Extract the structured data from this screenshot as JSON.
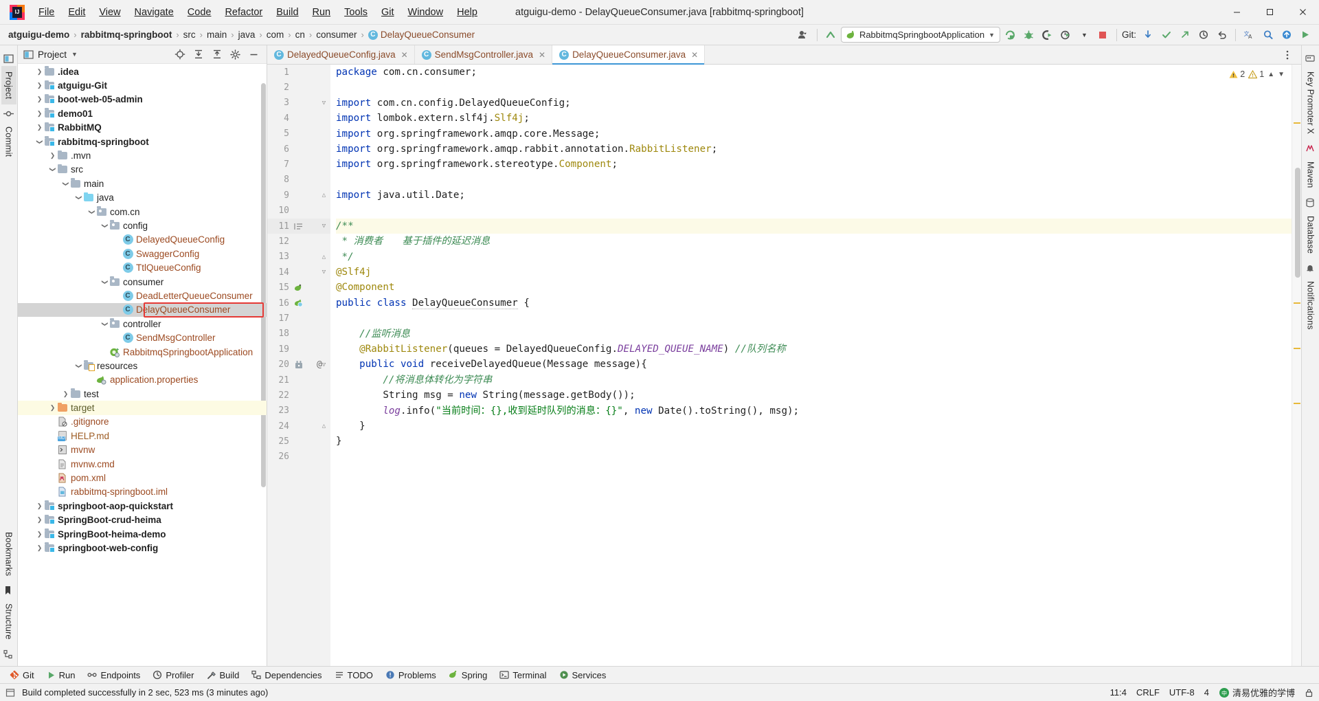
{
  "window": {
    "title": "atguigu-demo - DelayQueueConsumer.java [rabbitmq-springboot]",
    "minimize": "–",
    "maximize": "☐",
    "close": "✕"
  },
  "menubar": {
    "items": [
      {
        "label": "File",
        "mnemonic": "F"
      },
      {
        "label": "Edit",
        "mnemonic": "E"
      },
      {
        "label": "View",
        "mnemonic": "V"
      },
      {
        "label": "Navigate",
        "mnemonic": "N"
      },
      {
        "label": "Code",
        "mnemonic": "C"
      },
      {
        "label": "Refactor",
        "mnemonic": "R"
      },
      {
        "label": "Build",
        "mnemonic": "B"
      },
      {
        "label": "Run",
        "mnemonic": "u"
      },
      {
        "label": "Tools",
        "mnemonic": "T"
      },
      {
        "label": "Git",
        "mnemonic": "G"
      },
      {
        "label": "Window",
        "mnemonic": "W"
      },
      {
        "label": "Help",
        "mnemonic": "H"
      }
    ]
  },
  "navbar": {
    "breadcrumbs": [
      {
        "label": "atguigu-demo",
        "bold": true,
        "kind": "project"
      },
      {
        "label": "rabbitmq-springboot",
        "bold": true,
        "kind": "module"
      },
      {
        "label": "src",
        "bold": false,
        "kind": "folder"
      },
      {
        "label": "main",
        "bold": false,
        "kind": "folder"
      },
      {
        "label": "java",
        "bold": false,
        "kind": "folder"
      },
      {
        "label": "com",
        "bold": false,
        "kind": "package"
      },
      {
        "label": "cn",
        "bold": false,
        "kind": "package"
      },
      {
        "label": "consumer",
        "bold": false,
        "kind": "package"
      },
      {
        "label": "DelayQueueConsumer",
        "bold": false,
        "kind": "class"
      }
    ],
    "separator": "›",
    "run_configuration": "RabbitmqSpringbootApplication",
    "git_label": "Git:",
    "icons": [
      "user-avatar-icon",
      "updates-arrow-icon",
      "run-icon",
      "debug-icon",
      "run-with-coverage-icon",
      "profiler-icon",
      "stop-icon",
      "git-pull-icon",
      "git-commit-icon",
      "git-push-icon",
      "git-history-icon",
      "undo-icon",
      "translate-icon",
      "search-everywhere-icon",
      "plugin-update-icon",
      "run-big-icon"
    ]
  },
  "left_rail": {
    "items": [
      {
        "label": "Project",
        "selected": true
      },
      {
        "label": "Commit",
        "selected": false
      }
    ],
    "bottom_items": [
      {
        "label": "Bookmarks"
      },
      {
        "label": "Structure"
      }
    ]
  },
  "right_rail": {
    "items": [
      {
        "label": "Key Promoter X"
      },
      {
        "label": "Maven"
      },
      {
        "label": "Database"
      },
      {
        "label": "Notifications"
      }
    ]
  },
  "project_panel": {
    "title": "Project",
    "actions": [
      "locate-icon",
      "expand-all-icon",
      "collapse-all-icon",
      "settings-gear-icon",
      "hide-icon"
    ],
    "tree": [
      {
        "label": ".idea",
        "indent": 1,
        "arrow": "collapsed",
        "icon": "folder",
        "style": "bold",
        "clipped": true
      },
      {
        "label": "atguigu-Git",
        "indent": 1,
        "arrow": "collapsed",
        "icon": "module",
        "style": "bold"
      },
      {
        "label": "boot-web-05-admin",
        "indent": 1,
        "arrow": "collapsed",
        "icon": "module",
        "style": "bold"
      },
      {
        "label": "demo01",
        "indent": 1,
        "arrow": "collapsed",
        "icon": "module",
        "style": "bold"
      },
      {
        "label": "RabbitMQ",
        "indent": 1,
        "arrow": "collapsed",
        "icon": "module",
        "style": "bold"
      },
      {
        "label": "rabbitmq-springboot",
        "indent": 1,
        "arrow": "expanded",
        "icon": "module",
        "style": "bold"
      },
      {
        "label": ".mvn",
        "indent": 2,
        "arrow": "collapsed",
        "icon": "folder",
        "style": "plain"
      },
      {
        "label": "src",
        "indent": 2,
        "arrow": "expanded",
        "icon": "folder",
        "style": "plain"
      },
      {
        "label": "main",
        "indent": 3,
        "arrow": "expanded",
        "icon": "folder",
        "style": "plain"
      },
      {
        "label": "java",
        "indent": 4,
        "arrow": "expanded",
        "icon": "source-folder",
        "style": "plain"
      },
      {
        "label": "com.cn",
        "indent": 5,
        "arrow": "expanded",
        "icon": "package",
        "style": "plain"
      },
      {
        "label": "config",
        "indent": 6,
        "arrow": "expanded",
        "icon": "package",
        "style": "plain"
      },
      {
        "label": "DelayedQueueConfig",
        "indent": 7,
        "arrow": "none",
        "icon": "java-class",
        "style": "class"
      },
      {
        "label": "SwaggerConfig",
        "indent": 7,
        "arrow": "none",
        "icon": "java-class",
        "style": "class"
      },
      {
        "label": "TtlQueueConfig",
        "indent": 7,
        "arrow": "none",
        "icon": "java-class",
        "style": "class"
      },
      {
        "label": "consumer",
        "indent": 6,
        "arrow": "expanded",
        "icon": "package",
        "style": "plain"
      },
      {
        "label": "DeadLetterQueueConsumer",
        "indent": 7,
        "arrow": "none",
        "icon": "java-class",
        "style": "class"
      },
      {
        "label": "DelayQueueConsumer",
        "indent": 7,
        "arrow": "none",
        "icon": "java-class",
        "style": "class",
        "selected": true,
        "highlighted": true
      },
      {
        "label": "controller",
        "indent": 6,
        "arrow": "expanded",
        "icon": "package",
        "style": "plain"
      },
      {
        "label": "SendMsgController",
        "indent": 7,
        "arrow": "none",
        "icon": "java-class",
        "style": "class"
      },
      {
        "label": "RabbitmqSpringbootApplication",
        "indent": 6,
        "arrow": "none",
        "icon": "spring-boot-app",
        "style": "class"
      },
      {
        "label": "resources",
        "indent": 4,
        "arrow": "expanded",
        "icon": "resources-folder",
        "style": "plain"
      },
      {
        "label": "application.properties",
        "indent": 5,
        "arrow": "none",
        "icon": "spring-properties",
        "style": "class"
      },
      {
        "label": "test",
        "indent": 3,
        "arrow": "collapsed",
        "icon": "folder",
        "style": "plain"
      },
      {
        "label": "target",
        "indent": 2,
        "arrow": "collapsed",
        "icon": "excluded-folder",
        "style": "target",
        "row_highlight": true
      },
      {
        "label": ".gitignore",
        "indent": 2,
        "arrow": "none",
        "icon": "gitignore-file",
        "style": "class"
      },
      {
        "label": "HELP.md",
        "indent": 2,
        "arrow": "none",
        "icon": "markdown-file",
        "style": "markdown"
      },
      {
        "label": "mvnw",
        "indent": 2,
        "arrow": "none",
        "icon": "script-file",
        "style": "class"
      },
      {
        "label": "mvnw.cmd",
        "indent": 2,
        "arrow": "none",
        "icon": "text-file",
        "style": "class"
      },
      {
        "label": "pom.xml",
        "indent": 2,
        "arrow": "none",
        "icon": "maven-pom",
        "style": "class"
      },
      {
        "label": "rabbitmq-springboot.iml",
        "indent": 2,
        "arrow": "none",
        "icon": "module-file",
        "style": "class"
      },
      {
        "label": "springboot-aop-quickstart",
        "indent": 1,
        "arrow": "collapsed",
        "icon": "module",
        "style": "bold"
      },
      {
        "label": "SpringBoot-crud-heima",
        "indent": 1,
        "arrow": "collapsed",
        "icon": "module",
        "style": "bold"
      },
      {
        "label": "SpringBoot-heima-demo",
        "indent": 1,
        "arrow": "collapsed",
        "icon": "module",
        "style": "bold"
      },
      {
        "label": "springboot-web-config",
        "indent": 1,
        "arrow": "collapsed",
        "icon": "module",
        "style": "bold",
        "clipped": true
      }
    ]
  },
  "editor": {
    "tabs": [
      {
        "label": "DelayedQueueConfig.java",
        "active": false
      },
      {
        "label": "SendMsgController.java",
        "active": false
      },
      {
        "label": "DelayQueueConsumer.java",
        "active": true
      }
    ],
    "inspection": {
      "warnings": "2",
      "weak_warnings": "1",
      "warning_icon": "warning-triangle-icon",
      "weak_warning_icon": "weak-warning-icon",
      "up_icon": "chevron-up-icon",
      "down_icon": "chevron-down-icon"
    },
    "lines": [
      {
        "n": 1,
        "tokens": [
          {
            "t": "package ",
            "c": "kw"
          },
          {
            "t": "com.cn.consumer;",
            "c": "pl"
          }
        ]
      },
      {
        "n": 2,
        "tokens": []
      },
      {
        "n": 3,
        "fold": "start",
        "tokens": [
          {
            "t": "import ",
            "c": "kw"
          },
          {
            "t": "com.cn.config.DelayedQueueConfig;",
            "c": "pl"
          }
        ]
      },
      {
        "n": 4,
        "tokens": [
          {
            "t": "import ",
            "c": "kw"
          },
          {
            "t": "lombok.extern.slf4j.",
            "c": "pl"
          },
          {
            "t": "Slf4j",
            "c": "anno"
          },
          {
            "t": ";",
            "c": "pl"
          }
        ]
      },
      {
        "n": 5,
        "tokens": [
          {
            "t": "import ",
            "c": "kw"
          },
          {
            "t": "org.springframework.amqp.core.Message;",
            "c": "pl"
          }
        ]
      },
      {
        "n": 6,
        "tokens": [
          {
            "t": "import ",
            "c": "kw"
          },
          {
            "t": "org.springframework.amqp.rabbit.annotation.",
            "c": "pl"
          },
          {
            "t": "RabbitListener",
            "c": "anno"
          },
          {
            "t": ";",
            "c": "pl"
          }
        ]
      },
      {
        "n": 7,
        "tokens": [
          {
            "t": "import ",
            "c": "kw"
          },
          {
            "t": "org.springframework.stereotype.",
            "c": "pl"
          },
          {
            "t": "Component",
            "c": "anno"
          },
          {
            "t": ";",
            "c": "pl"
          }
        ]
      },
      {
        "n": 8,
        "tokens": []
      },
      {
        "n": 9,
        "fold": "end",
        "tokens": [
          {
            "t": "import ",
            "c": "kw"
          },
          {
            "t": "java.util.Date;",
            "c": "pl"
          }
        ]
      },
      {
        "n": 10,
        "bulb": true,
        "tokens": []
      },
      {
        "n": 11,
        "highlight": true,
        "fold": "start",
        "gutter_icon": "doc-icon",
        "tokens": [
          {
            "t": "/**",
            "c": "cmt"
          }
        ]
      },
      {
        "n": 12,
        "tokens": [
          {
            "t": " * 消费者　　基于插件的延迟消息",
            "c": "cmt"
          }
        ]
      },
      {
        "n": 13,
        "fold": "end",
        "tokens": [
          {
            "t": " */",
            "c": "cmt"
          }
        ]
      },
      {
        "n": 14,
        "fold": "start",
        "tokens": [
          {
            "t": "@Slf4j",
            "c": "anno"
          }
        ]
      },
      {
        "n": 15,
        "gutter_icon": "spring-bean-icon",
        "tokens": [
          {
            "t": "@Component",
            "c": "anno"
          }
        ]
      },
      {
        "n": 16,
        "gutter_icon": "spring-bean-class-icon",
        "tokens": [
          {
            "t": "public ",
            "c": "kw"
          },
          {
            "t": "class ",
            "c": "kw"
          },
          {
            "t": "DelayQueueConsumer",
            "c": "cls2"
          },
          {
            "t": " {",
            "c": "pl"
          }
        ]
      },
      {
        "n": 17,
        "tokens": []
      },
      {
        "n": 18,
        "tokens": [
          {
            "t": "    //监听消息",
            "c": "cmt"
          }
        ]
      },
      {
        "n": 19,
        "tokens": [
          {
            "t": "    @RabbitListener",
            "c": "anno"
          },
          {
            "t": "(queues = DelayedQueueConfig.",
            "c": "pl"
          },
          {
            "t": "DELAYED_QUEUE_NAME",
            "c": "const"
          },
          {
            "t": ") ",
            "c": "pl"
          },
          {
            "t": "//队列名称",
            "c": "cmt"
          }
        ]
      },
      {
        "n": 20,
        "gutter_icon": "rabbit-listener-icon",
        "gutter_at": true,
        "fold": "start",
        "tokens": [
          {
            "t": "    public ",
            "c": "kw"
          },
          {
            "t": "void ",
            "c": "kw"
          },
          {
            "t": "receiveDelayedQueue",
            "c": "pl"
          },
          {
            "t": "(Message message){",
            "c": "pl"
          }
        ]
      },
      {
        "n": 21,
        "tokens": [
          {
            "t": "        //将消息体转化为字符串",
            "c": "cmt"
          }
        ]
      },
      {
        "n": 22,
        "tokens": [
          {
            "t": "        String msg = ",
            "c": "pl"
          },
          {
            "t": "new ",
            "c": "kw"
          },
          {
            "t": "String(message.getBody());",
            "c": "pl"
          }
        ]
      },
      {
        "n": 23,
        "tokens": [
          {
            "t": "        log",
            "c": "const"
          },
          {
            "t": ".info(",
            "c": "pl"
          },
          {
            "t": "\"当前时间：{},收到延时队列的消息：{}\"",
            "c": "str"
          },
          {
            "t": ", ",
            "c": "pl"
          },
          {
            "t": "new ",
            "c": "kw"
          },
          {
            "t": "Date().toString(), msg);",
            "c": "pl"
          }
        ]
      },
      {
        "n": 24,
        "fold": "end",
        "tokens": [
          {
            "t": "    }",
            "c": "pl"
          }
        ]
      },
      {
        "n": 25,
        "tokens": [
          {
            "t": "}",
            "c": "pl"
          }
        ]
      },
      {
        "n": 26,
        "tokens": []
      }
    ]
  },
  "bottom_toolbar": {
    "items": [
      {
        "label": "Git",
        "icon": "git-icon"
      },
      {
        "label": "Run",
        "icon": "run-icon"
      },
      {
        "label": "Endpoints",
        "icon": "endpoints-icon"
      },
      {
        "label": "Profiler",
        "icon": "profiler-icon"
      },
      {
        "label": "Build",
        "icon": "build-hammer-icon"
      },
      {
        "label": "Dependencies",
        "icon": "dependencies-icon"
      },
      {
        "label": "TODO",
        "icon": "todo-icon"
      },
      {
        "label": "Problems",
        "icon": "problems-icon"
      },
      {
        "label": "Spring",
        "icon": "spring-leaf-icon"
      },
      {
        "label": "Terminal",
        "icon": "terminal-icon"
      },
      {
        "label": "Services",
        "icon": "services-icon"
      }
    ]
  },
  "statusbar": {
    "message": "Build completed successfully in 2 sec, 523 ms (3 minutes ago)",
    "message_icon": "build-status-icon",
    "caret_position": "11:4",
    "line_separator": "CRLF",
    "encoding": "UTF-8",
    "indent": "4",
    "ime_label": "清易优雅的学博",
    "lock_icon": "lock-icon"
  },
  "colors": {
    "accent_blue": "#3d96d6",
    "keyword": "#0033b3",
    "annotation": "#9e880d",
    "comment": "#3d8b54",
    "string": "#067d17",
    "constant": "#7a3e9d",
    "class_file": "#9c4a21",
    "selection": "#d4d4d4",
    "caret_line": "#fcfae7",
    "red_annotation": "#e53935",
    "target_row": "#fdfbe3"
  }
}
